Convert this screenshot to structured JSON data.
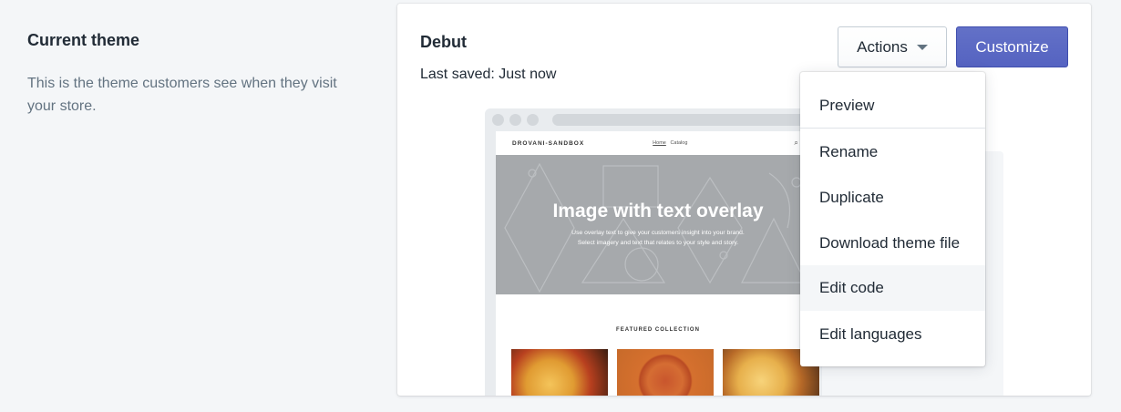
{
  "annotation": {
    "title": "Current theme",
    "description": "This is the theme customers see when they visit your store."
  },
  "theme": {
    "name": "Debut",
    "last_saved": "Last saved: Just now"
  },
  "buttons": {
    "actions": "Actions",
    "customize": "Customize"
  },
  "preview": {
    "brand": "DROVANI-SANDBOX",
    "nav": [
      "Home",
      "Catalog"
    ],
    "hero_title": "Image with text overlay",
    "hero_sub_1": "Use overlay text to give your customers insight into your brand.",
    "hero_sub_2": "Select imagery and text that relates to your style and story.",
    "featured": "FEATURED COLLECTION"
  },
  "menu": {
    "items": [
      "Preview",
      "Rename",
      "Duplicate",
      "Download theme file",
      "Edit code",
      "Edit languages"
    ],
    "hovered": "Edit code"
  },
  "colors": {
    "primary": "#5c6ac4",
    "background": "#f4f6f8"
  }
}
